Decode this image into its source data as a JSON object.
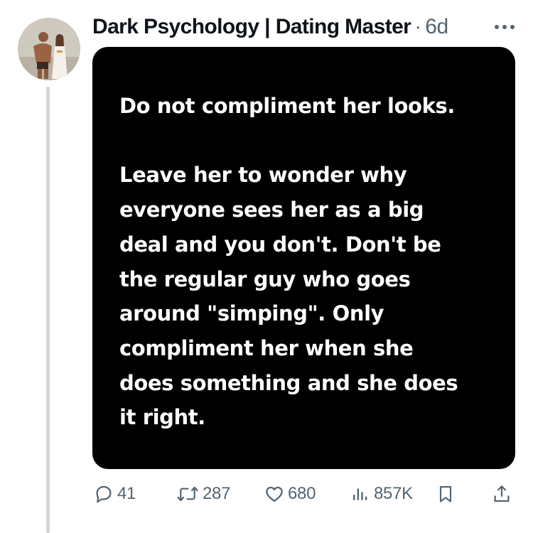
{
  "post": {
    "author": "Dark Psychology | Dating Master",
    "separator": "·",
    "time": "6d",
    "avatar_icon": "profile-avatar",
    "more_icon": "more-horizontal-icon",
    "card": {
      "background": "#000000",
      "text_color": "#ffffff",
      "heading": "Do not compliment her looks.",
      "body_lines": [
        "Leave her to wonder why",
        "everyone sees her as a big",
        "deal and you don't. Don't be",
        "the regular guy who goes",
        "around \"simping\". Only",
        "compliment her when she",
        "does something and she does",
        "it right."
      ]
    },
    "actions": {
      "reply": {
        "icon": "reply-icon",
        "count": "41"
      },
      "repost": {
        "icon": "repost-icon",
        "count": "287"
      },
      "like": {
        "icon": "heart-icon",
        "count": "680"
      },
      "views": {
        "icon": "views-icon",
        "count": "857K"
      },
      "bookmark": {
        "icon": "bookmark-icon"
      },
      "share": {
        "icon": "share-icon"
      }
    },
    "colors": {
      "text_primary": "#0f1419",
      "text_secondary": "#536471",
      "thread_line": "#cfd9de"
    }
  }
}
